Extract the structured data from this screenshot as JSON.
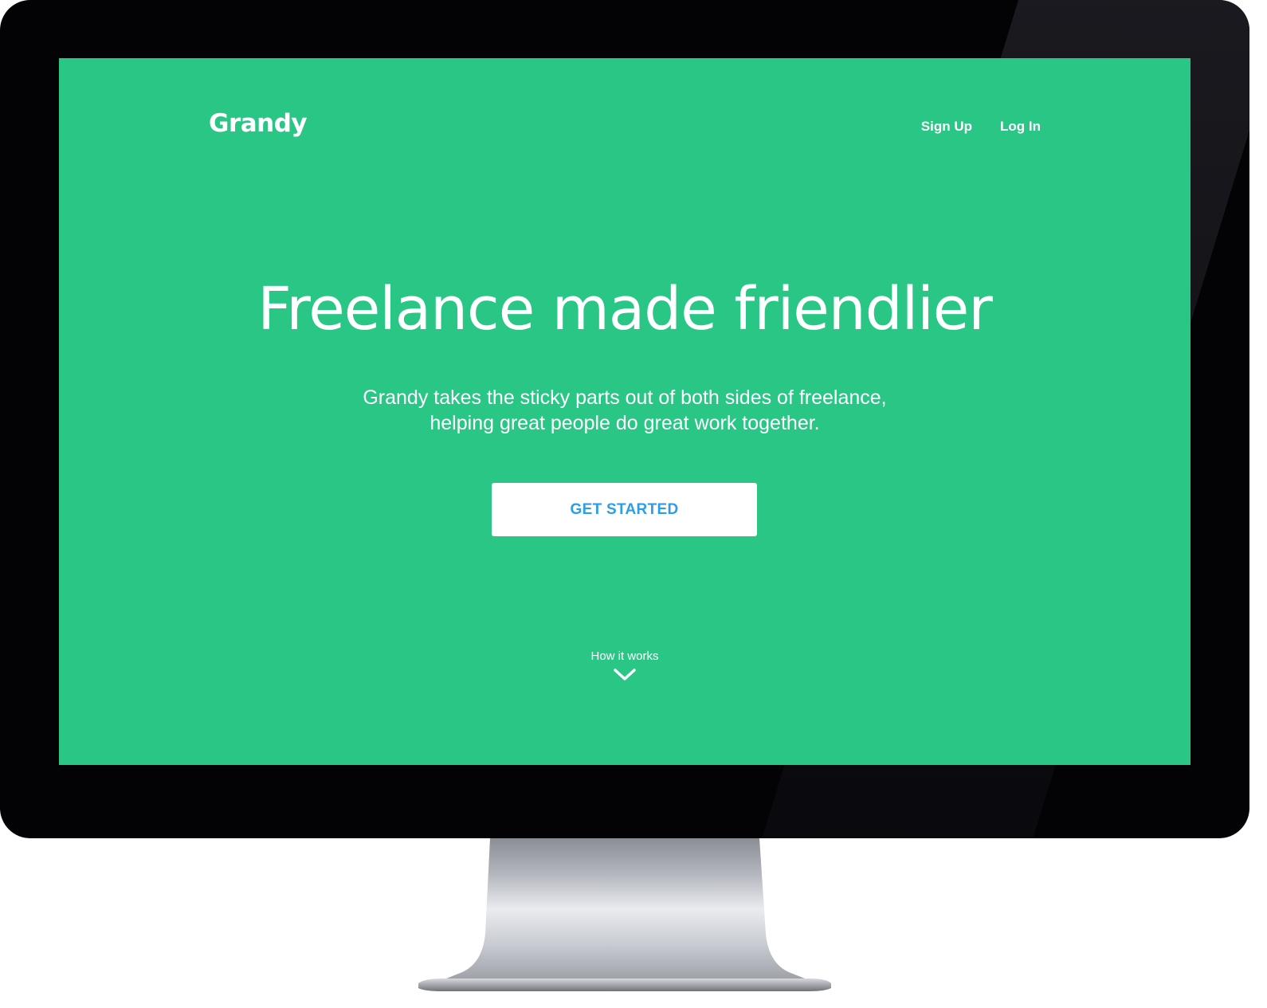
{
  "brand": {
    "name": "Grandy"
  },
  "nav": {
    "signup_label": "Sign Up",
    "login_label": "Log In"
  },
  "hero": {
    "headline": "Freelance made friendlier",
    "subtitle_line1": "Grandy takes the sticky parts out of both sides of freelance,",
    "subtitle_line2": "helping great people do great work together.",
    "cta_label": "GET STARTED"
  },
  "scroll_hint": {
    "label": "How it works",
    "icon": "chevron-down-icon"
  },
  "colors": {
    "background": "#29c686",
    "cta_text": "#2d9de4",
    "text": "#ffffff",
    "bezel": "#030306"
  }
}
